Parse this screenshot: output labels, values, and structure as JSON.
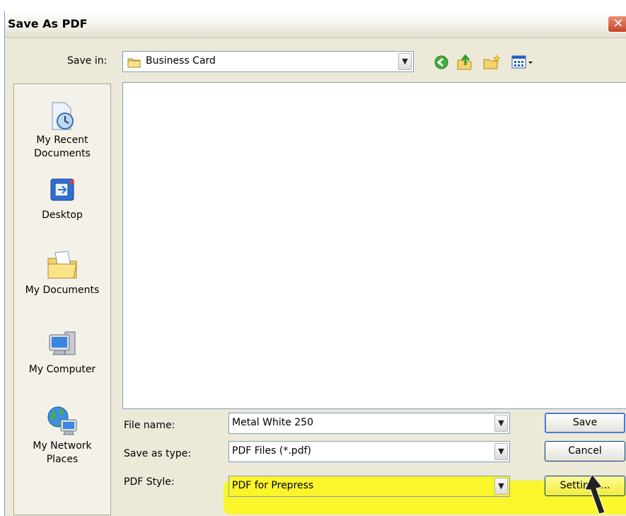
{
  "window": {
    "title": "Save As PDF",
    "close_glyph": "✕"
  },
  "save_in": {
    "label": "Save in:",
    "value": "Business Card"
  },
  "toolbar_icons": [
    "back-icon",
    "up-folder-icon",
    "new-folder-icon",
    "view-menu-icon"
  ],
  "places": [
    {
      "label": "My Recent Documents",
      "line1": "My Recent",
      "line2": "Documents",
      "icon": "recent-documents-icon"
    },
    {
      "label": "Desktop",
      "line1": "Desktop",
      "line2": "",
      "icon": "desktop-icon"
    },
    {
      "label": "My Documents",
      "line1": "My Documents",
      "line2": "",
      "icon": "my-documents-icon"
    },
    {
      "label": "My Computer",
      "line1": "My Computer",
      "line2": "",
      "icon": "my-computer-icon"
    },
    {
      "label": "My Network Places",
      "line1": "My Network",
      "line2": "Places",
      "icon": "network-places-icon"
    }
  ],
  "file_name": {
    "label": "File name:",
    "value": "Metal White 250"
  },
  "save_as_type": {
    "label": "Save as type:",
    "value": "PDF Files (*.pdf)"
  },
  "pdf_style": {
    "label": "PDF Style:",
    "value": "PDF for Prepress"
  },
  "buttons": {
    "save": "Save",
    "cancel": "Cancel",
    "settings": "Settings..."
  },
  "dropdown_glyph": "▼",
  "colors": {
    "highlight": "#fbf52b",
    "dialog_bg": "#ece9d8",
    "close_red": "#c8452a"
  }
}
